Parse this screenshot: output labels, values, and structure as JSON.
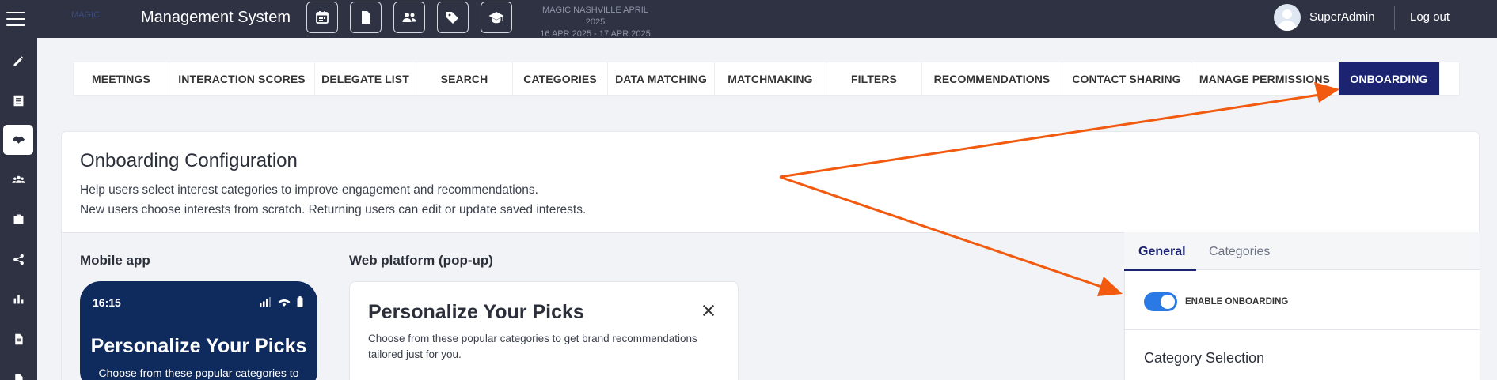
{
  "header": {
    "logo_text": "MAGIC",
    "title": "Management System",
    "event_name": "MAGIC NASHVILLE APRIL 2025",
    "event_dates": "16 APR 2025 - 17 APR 2025",
    "username": "SuperAdmin",
    "logout_label": "Log out",
    "toolbar_icons": [
      "calendar-icon",
      "document-icon",
      "users-icon",
      "tag-icon",
      "graduation-cap-icon"
    ]
  },
  "sidebar": {
    "items": [
      {
        "icon": "pencil-icon",
        "active": false
      },
      {
        "icon": "list-icon",
        "active": false
      },
      {
        "icon": "handshake-icon",
        "active": true
      },
      {
        "icon": "group-icon",
        "active": false
      },
      {
        "icon": "briefcase-icon",
        "active": false
      },
      {
        "icon": "share-icon",
        "active": false
      },
      {
        "icon": "bar-chart-icon",
        "active": false
      },
      {
        "icon": "file-icon",
        "active": false
      }
    ]
  },
  "tabs": [
    {
      "label": "MEETINGS",
      "active": false
    },
    {
      "label": "INTERACTION SCORES",
      "active": false
    },
    {
      "label": "DELEGATE LIST",
      "active": false
    },
    {
      "label": "SEARCH",
      "active": false
    },
    {
      "label": "CATEGORIES",
      "active": false
    },
    {
      "label": "DATA MATCHING",
      "active": false
    },
    {
      "label": "MATCHMAKING",
      "active": false
    },
    {
      "label": "FILTERS",
      "active": false
    },
    {
      "label": "RECOMMENDATIONS",
      "active": false
    },
    {
      "label": "CONTACT SHARING",
      "active": false
    },
    {
      "label": "MANAGE PERMISSIONS",
      "active": false
    },
    {
      "label": "ONBOARDING",
      "active": true
    }
  ],
  "onboarding": {
    "title": "Onboarding Configuration",
    "description_1": "Help users select interest categories to improve engagement and recommendations.",
    "description_2": "New users choose interests from scratch. Returning users can edit or update saved interests.",
    "mobile_label": "Mobile app",
    "web_label": "Web platform (pop-up)",
    "mobile_preview": {
      "time": "16:15",
      "heading": "Personalize Your Picks",
      "subtext": "Choose from these popular categories to"
    },
    "web_preview": {
      "heading": "Personalize Your Picks",
      "text": "Choose from these popular categories to get brand recommendations tailored just for you."
    }
  },
  "settings": {
    "tabs": [
      {
        "label": "General",
        "active": true
      },
      {
        "label": "Categories",
        "active": false
      }
    ],
    "enable_label": "ENABLE ONBOARDING",
    "enabled": true,
    "category_selection_title": "Category Selection"
  },
  "colors": {
    "topbar": "#2e3243",
    "active_tab": "#1c2472",
    "toggle_on": "#2a79e4",
    "annotation_arrow": "#f15a0f",
    "phone_bg": "#0f2a5c"
  }
}
